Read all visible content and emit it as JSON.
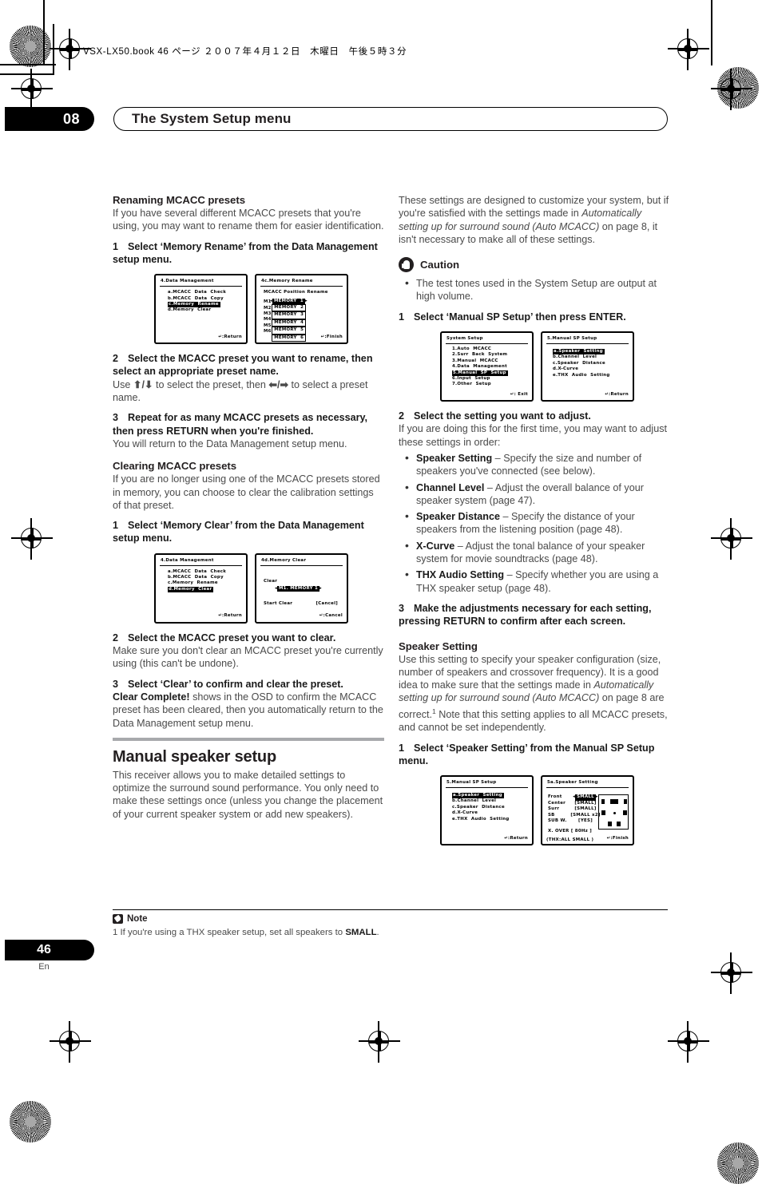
{
  "header": {
    "book_line": "VSX-LX50.book  46 ページ  ２００７年４月１２日　木曜日　午後５時３分",
    "chapter_number": "08",
    "chapter_title": "The System Setup menu"
  },
  "left_column": {
    "section1_heading": "Renaming MCACC presets",
    "section1_intro": "If you have several different MCACC presets that you're using, you may want to rename them for easier identification.",
    "section1_step1_num": "1",
    "section1_step1": "Select ‘Memory Rename’ from the Data Management setup menu.",
    "section1_step2_num": "2",
    "section1_step2": "Select the MCACC preset you want to rename, then select an appropriate preset name.",
    "section1_step2_body_a": "Use ",
    "section1_step2_body_b": " to select the preset, then ",
    "section1_step2_body_c": " to select a preset name.",
    "section1_step3_num": "3",
    "section1_step3": "Repeat for as many MCACC presets as necessary, then press RETURN when you're finished.",
    "section1_step3_body": "You will return to the Data Management setup menu.",
    "section2_heading": "Clearing MCACC presets",
    "section2_intro": "If you are no longer using one of the MCACC presets stored in memory, you can choose to clear the calibration settings of that preset.",
    "section2_step1_num": "1",
    "section2_step1": "Select ‘Memory Clear’ from the Data Management setup menu.",
    "section2_step2_num": "2",
    "section2_step2": "Select the MCACC preset you want to clear.",
    "section2_step2_body": "Make sure you don't clear an MCACC preset you're currently using (this can't be undone).",
    "section2_step3_num": "3",
    "section2_step3": "Select ‘Clear’ to confirm and clear the preset.",
    "section2_step3_bold": "Clear Complete!",
    "section2_step3_body": " shows in the OSD to confirm the MCACC preset has been cleared, then you automatically return to the Data Management setup menu.",
    "section3_heading": "Manual speaker setup",
    "section3_body": "This receiver allows you to make detailed settings to optimize the surround sound performance. You only need to make these settings once (unless you change the placement of your current speaker system or add new speakers)."
  },
  "right_column": {
    "intro_a": "These settings are designed to customize your system, but if you're satisfied with the settings made in ",
    "intro_italic": "Automatically setting up for surround sound (Auto MCACC)",
    "intro_b": " on page 8, it isn't necessary to make all of these settings.",
    "caution_label": "Caution",
    "caution_bullet": "The test tones used in the System Setup are output at high volume.",
    "step1_num": "1",
    "step1": "Select ‘Manual SP Setup’ then press ENTER.",
    "step2_num": "2",
    "step2": "Select the setting you want to adjust.",
    "step2_body": "If you are doing this for the first time, you may want to adjust these settings in order:",
    "bullets": [
      {
        "term": "Speaker Setting",
        "desc": " – Specify the size and number of speakers you've connected (see below)."
      },
      {
        "term": "Channel Level",
        "desc": " – Adjust the overall balance of your speaker system (page 47)."
      },
      {
        "term": "Speaker Distance",
        "desc": " – Specify the distance of your speakers from the listening position (page 48)."
      },
      {
        "term": "X-Curve",
        "desc": " – Adjust the tonal balance of your speaker system for movie soundtracks (page 48)."
      },
      {
        "term": "THX Audio Setting",
        "desc": " – Specify whether you are using a THX speaker setup (page 48)."
      }
    ],
    "step3_num": "3",
    "step3": "Make the adjustments necessary for each setting, pressing RETURN to confirm after each screen.",
    "spk_heading": "Speaker Setting",
    "spk_body_a": "Use this setting to specify your speaker configuration (size, number of speakers and crossover frequency). It is a good idea to make sure that the settings made in ",
    "spk_body_italic": "Automatically setting up for surround sound (Auto MCACC)",
    "spk_body_b": " on page 8 are correct.",
    "spk_footnote_marker": "1",
    "spk_body_c": " Note that this setting applies to all MCACC presets, and cannot be set independently.",
    "spk_step1_num": "1",
    "spk_step1": "Select ‘Speaker Setting’ from the Manual SP Setup menu."
  },
  "osd_figures": {
    "fig1_left": {
      "title": "4.Data  Management",
      "items": [
        "a.MCACC  Data  Check",
        "b.MCACC  Data  Copy",
        "c.Memory  Rename",
        "d.Memory  Clear"
      ],
      "highlight_index": 2,
      "footer": ":Return"
    },
    "fig1_right": {
      "title": "4c.Memory  Rename",
      "subtitle": "MCACC  Position  Rename",
      "rows": [
        {
          "label": "M1",
          "value": "MEMORY  1",
          "selected": true
        },
        {
          "label": "M2",
          "value": "MEMORY  2",
          "selected": false
        },
        {
          "label": "M3",
          "value": "MEMORY  3",
          "selected": false
        },
        {
          "label": "M4",
          "value": "MEMORY  4",
          "selected": false
        },
        {
          "label": "M5",
          "value": "MEMORY  5",
          "selected": false
        },
        {
          "label": "M6",
          "value": "MEMORY  6",
          "selected": false
        }
      ],
      "footer": ":Finish"
    },
    "fig2_left": {
      "title": "4.Data  Management",
      "items": [
        "a.MCACC  Data  Check",
        "b.MCACC  Data  Copy",
        "c.Memory  Rename",
        "d.Memory  Clear"
      ],
      "highlight_index": 3,
      "footer": ":Return"
    },
    "fig2_right": {
      "title": "4d.Memory  Clear",
      "label_clear": "Clear",
      "value_clear": "M1. MEMORY  1",
      "label_start": "Start  Clear",
      "value_start": "[Cancel]",
      "footer": ":Cancel"
    },
    "fig3_left": {
      "title": "System  Setup",
      "items": [
        "1.Auto  MCACC",
        "2.Surr  Back  System",
        "3.Manual  MCACC",
        "4.Data  Management",
        "5.Manual  SP  Setup",
        "6.Input  Setup",
        "7.Other  Setup"
      ],
      "highlight_index": 4,
      "footer": ": Exit"
    },
    "fig3_right": {
      "title": "5.Manual  SP  Setup",
      "items": [
        "a.Speaker  Setting",
        "b.Channel  Level",
        "c.Speaker  Distance",
        "d.X-Curve",
        "e.THX  Audio  Setting"
      ],
      "highlight_index": 0,
      "footer": ":Return"
    },
    "fig4_left": {
      "title": "5.Manual  SP  Setup",
      "items": [
        "a.Speaker  Setting",
        "b.Channel  Level",
        "c.Speaker  Distance",
        "d.X-Curve",
        "e.THX  Audio  Setting"
      ],
      "highlight_index": 0,
      "footer": ":Return"
    },
    "fig4_right": {
      "title": "5a.Speaker  Setting",
      "rows": [
        {
          "label": "Front",
          "value": "SMALL",
          "selected": true
        },
        {
          "label": "Center",
          "value": "SMALL",
          "selected": false
        },
        {
          "label": "Surr",
          "value": "SMALL",
          "selected": false
        },
        {
          "label": "SB",
          "value": "SMALL x2",
          "selected": false
        },
        {
          "label": "SUB W.",
          "value": "YES",
          "selected": false
        }
      ],
      "xover_label": "X. OVER",
      "xover_value": "80Hz",
      "thx_line": "(THX:ALL  SMALL )",
      "footer": ":Finish"
    }
  },
  "footer": {
    "note_label": "Note",
    "note_text_a": "1 If you're using a THX speaker setup, set all speakers to ",
    "note_text_bold": "SMALL",
    "note_text_b": ".",
    "page_number": "46",
    "page_lang": "En"
  }
}
